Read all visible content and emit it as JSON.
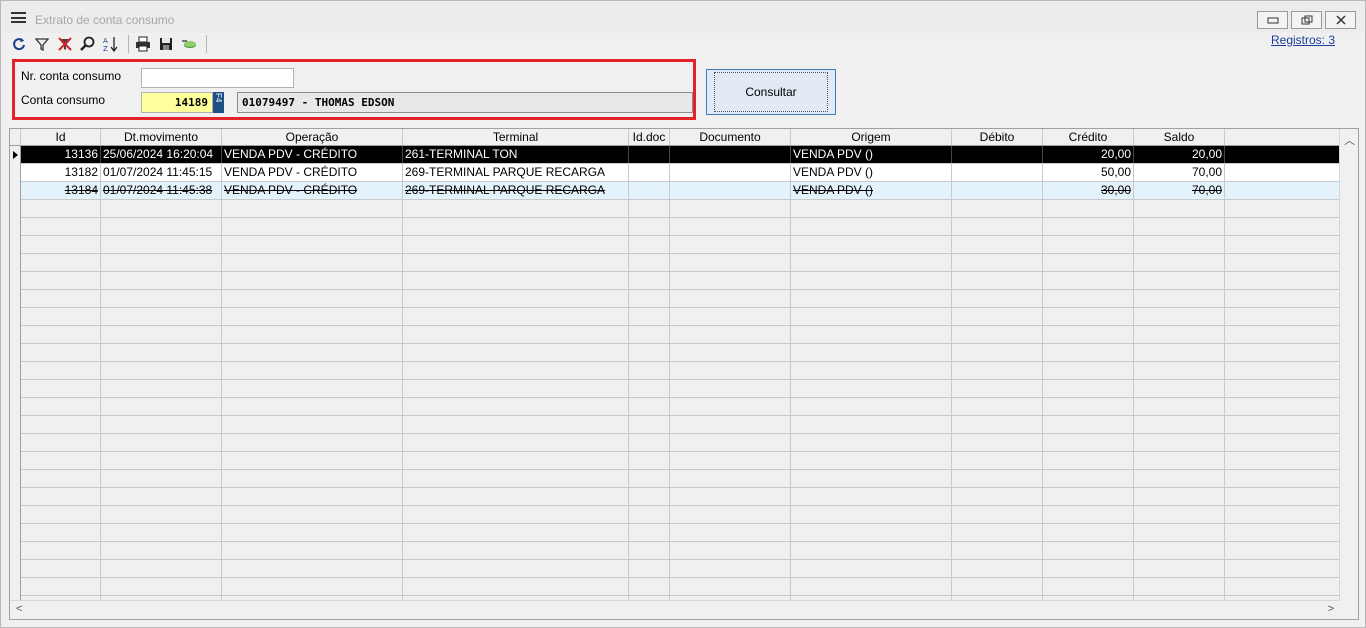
{
  "window": {
    "title": "Extrato de conta consumo",
    "min_label": "▭",
    "restore_label": "🗗",
    "close_label": "✕"
  },
  "toolbar": {
    "icons": [
      "refresh-icon",
      "filter-icon",
      "clear-filter-icon",
      "search-icon",
      "sort-icon",
      "print-icon",
      "save-icon",
      "export-icon"
    ],
    "registros": "Registros: 3"
  },
  "filter": {
    "nr_label": "Nr. conta consumo",
    "nr_value": "",
    "conta_label": "Conta consumo",
    "conta_value": "14189",
    "f4_label": "F4",
    "conta_name": "01079497 - THOMAS EDSON",
    "consultar_label": "Consultar"
  },
  "grid": {
    "columns": [
      "Id",
      "Dt.movimento",
      "Operação",
      "Terminal",
      "Id.doc",
      "Documento",
      "Origem",
      "Débito",
      "Crédito",
      "Saldo"
    ],
    "rows": [
      {
        "id": "13136",
        "dt": "25/06/2024 16:20:04",
        "operacao": "VENDA PDV - CRÉDITO",
        "terminal": "261-TERMINAL TON",
        "iddoc": "",
        "documento": "",
        "origem": "VENDA PDV ()",
        "debito": "",
        "credito": "20,00",
        "saldo": "20,00",
        "state": "selected"
      },
      {
        "id": "13182",
        "dt": "01/07/2024 11:45:15",
        "operacao": "VENDA PDV - CRÉDITO",
        "terminal": "269-TERMINAL PARQUE RECARGA",
        "iddoc": "",
        "documento": "",
        "origem": "VENDA PDV ()",
        "debito": "",
        "credito": "50,00",
        "saldo": "70,00",
        "state": "normal"
      },
      {
        "id": "13184",
        "dt": "01/07/2024 11:45:38",
        "operacao": "VENDA PDV - CRÉDITO",
        "terminal": "269-TERMINAL PARQUE RECARGA",
        "iddoc": "",
        "documento": "",
        "origem": "VENDA PDV ()",
        "debito": "",
        "credito": "30,00",
        "saldo": "70,00",
        "state": "cancelled"
      }
    ]
  },
  "colors": {
    "highlight_border": "#e2232a",
    "selected_row": "#000000",
    "cancelled_row": "#e3f2fb",
    "input_yellow": "#ffff9c"
  }
}
